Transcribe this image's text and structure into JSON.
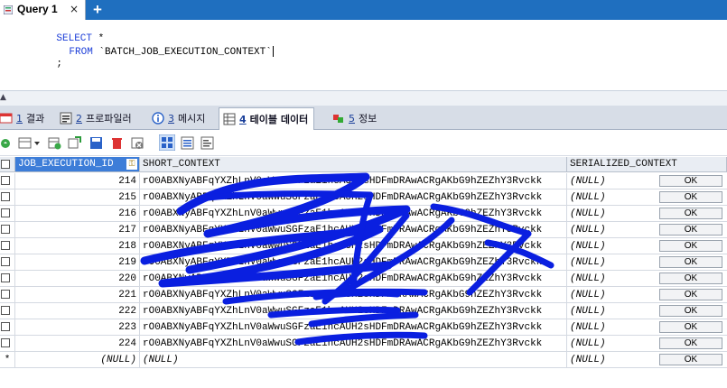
{
  "query_tab": {
    "label": "Query 1",
    "close": "×",
    "add": "+"
  },
  "editor": {
    "line1_kw": "SELECT",
    "line1_rest": " *",
    "line2_kw": "FROM",
    "line2_table": " `BATCH_JOB_EXECUTION_CONTEXT`",
    "line3": ";"
  },
  "result_tabs": [
    {
      "num": "1",
      "label": "결과"
    },
    {
      "num": "2",
      "label": "프로파일러"
    },
    {
      "num": "3",
      "label": "메시지"
    },
    {
      "num": "4",
      "label": "테이블 데이터"
    },
    {
      "num": "5",
      "label": "정보"
    }
  ],
  "columns": [
    "JOB_EXECUTION_ID",
    "SHORT_CONTEXT",
    "SERIALIZED_CONTEXT"
  ],
  "rows": [
    {
      "id": "214",
      "short": "rO0ABXNyABFqYXZhLnV0aWwuSGFzaE1hcAUH2sHDFmDRAwACRgAKbG9hZEZhY3Rvckk",
      "ser": "(NULL)",
      "btn": "OK"
    },
    {
      "id": "215",
      "short": "rO0ABXNyABFqYXZhLnV0aWwuSGFzaE1hcAUH2sHDFmDRAwACRgAKbG9hZEZhY3Rvckk",
      "ser": "(NULL)",
      "btn": "OK"
    },
    {
      "id": "216",
      "short": "rO0ABXNyABFqYXZhLnV0aWwuSGFzaE1hcAUH2sHDFmDRAwACRgAKbG9hZEZhY3Rvckk",
      "ser": "(NULL)",
      "btn": "OK"
    },
    {
      "id": "217",
      "short": "rO0ABXNyABFqYXZhLnV0aWwuSGFzaE1hcAUH2sHDFmDRAwACRgAKbG9hZEZhY3Rvckk",
      "ser": "(NULL)",
      "btn": "OK"
    },
    {
      "id": "218",
      "short": "rO0ABXNyABFqYXZhLnV0aWwuSGFzaE1hcAUH2sHDFmDRAwACRgAKbG9hZEZhY3Rvckk",
      "ser": "(NULL)",
      "btn": "OK"
    },
    {
      "id": "219",
      "short": "rO0ABXNyABFqYXZhLnV0aWwuSGFzaE1hcAUH2sHDFmDRAwACRgAKbG9hZEZhY3Rvckk",
      "ser": "(NULL)",
      "btn": "OK"
    },
    {
      "id": "220",
      "short": "rO0ABXNyABFqYXZhLnV0aWwuSGFzaE1hcAUH2sHDFmDRAwACRgAKbG9hZEZhY3Rvckk",
      "ser": "(NULL)",
      "btn": "OK"
    },
    {
      "id": "221",
      "short": "rO0ABXNyABFqYXZhLnV0aWwuSGFzaE1hcAUH2sHDFmDRAwACRgAKbG9hZEZhY3Rvckk",
      "ser": "(NULL)",
      "btn": "OK"
    },
    {
      "id": "222",
      "short": "rO0ABXNyABFqYXZhLnV0aWwuSGFzaE1hcAUH2sHDFmDRAwACRgAKbG9hZEZhY3Rvckk",
      "ser": "(NULL)",
      "btn": "OK"
    },
    {
      "id": "223",
      "short": "rO0ABXNyABFqYXZhLnV0aWwuSGFzaE1hcAUH2sHDFmDRAwACRgAKbG9hZEZhY3Rvckk",
      "ser": "(NULL)",
      "btn": "OK"
    },
    {
      "id": "224",
      "short": "rO0ABXNyABFqYXZhLnV0aWwuSGFzaE1hcAUH2sHDFmDRAwACRgAKbG9hZEZhY3Rvckk",
      "ser": "(NULL)",
      "btn": "OK"
    }
  ],
  "new_row": {
    "marker": "*",
    "id": "(NULL)",
    "short": "(NULL)",
    "ser": "(NULL)",
    "btn": "OK"
  },
  "colors": {
    "tabstrip": "#1f6fbf",
    "keyword": "#1d3fd8",
    "header_selected": "#3d7dd8",
    "scribble": "#0a1fe0"
  },
  "icons": [
    "query-editor-icon",
    "result-grid-icon",
    "profiler-icon",
    "info-icon",
    "table-icon",
    "info-gems-icon",
    "refresh-icon",
    "filter-dropdown-icon",
    "insert-row-icon",
    "duplicate-row-icon",
    "save-icon",
    "delete-icon",
    "cancel-icon",
    "grid-view-icon",
    "form-view-icon",
    "text-view-icon"
  ]
}
